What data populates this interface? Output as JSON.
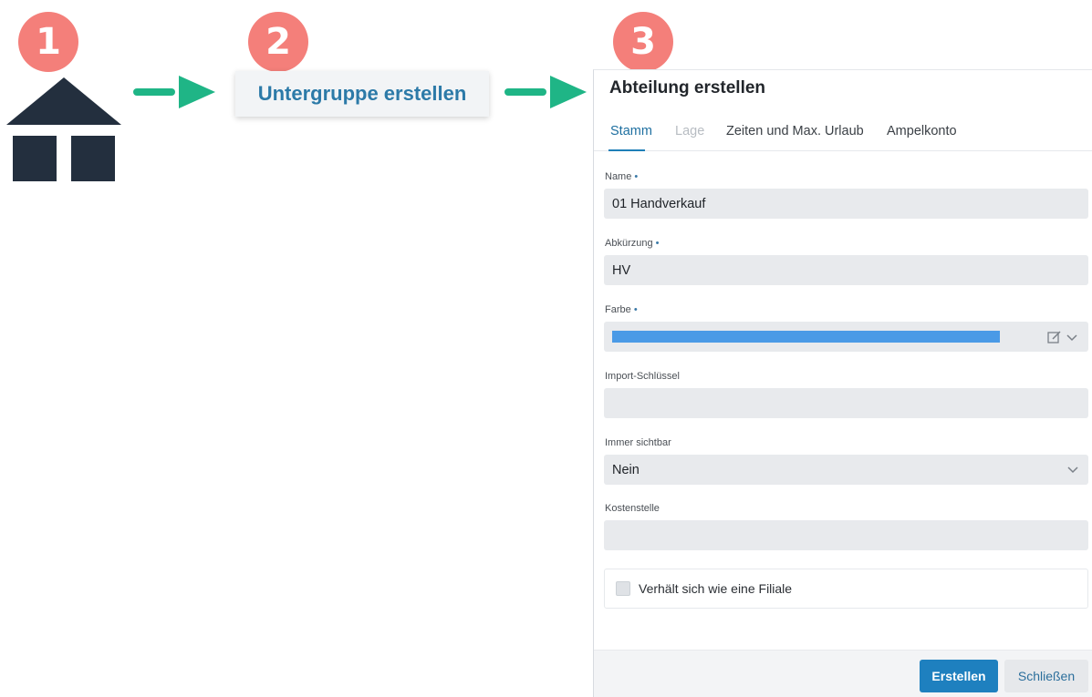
{
  "steps": [
    {
      "number": "1"
    },
    {
      "number": "2"
    },
    {
      "number": "3"
    }
  ],
  "subgroup": {
    "label": "Untergruppe erstellen"
  },
  "dialog": {
    "title": "Abteilung erstellen",
    "tabs": [
      {
        "label": "Stamm",
        "state": "active"
      },
      {
        "label": "Lage",
        "state": "disabled"
      },
      {
        "label": "Zeiten und Max. Urlaub",
        "state": "normal"
      },
      {
        "label": "Ampelkonto",
        "state": "normal"
      }
    ],
    "required_marker": "•",
    "fields": {
      "name": {
        "label": "Name",
        "value": "01 Handverkauf"
      },
      "abbreviation": {
        "label": "Abkürzung",
        "value": "HV"
      },
      "color": {
        "label": "Farbe",
        "value_color": "#4a9ae6"
      },
      "import_key": {
        "label": "Import-Schlüssel",
        "value": ""
      },
      "always_visible": {
        "label": "Immer sichtbar",
        "value": "Nein"
      },
      "cost_center": {
        "label": "Kostenstelle",
        "value": ""
      }
    },
    "checkbox": {
      "label": "Verhält sich wie eine Filiale",
      "checked": false
    },
    "buttons": {
      "create": "Erstellen",
      "close": "Schließen"
    }
  },
  "colors": {
    "badge": "#f47f7a",
    "arrow": "#1fb586",
    "house": "#232f3e",
    "accent": "#1e80bf"
  },
  "icons": [
    "house-icon",
    "arrow-right-icon",
    "edit-icon",
    "chevron-down-icon"
  ]
}
